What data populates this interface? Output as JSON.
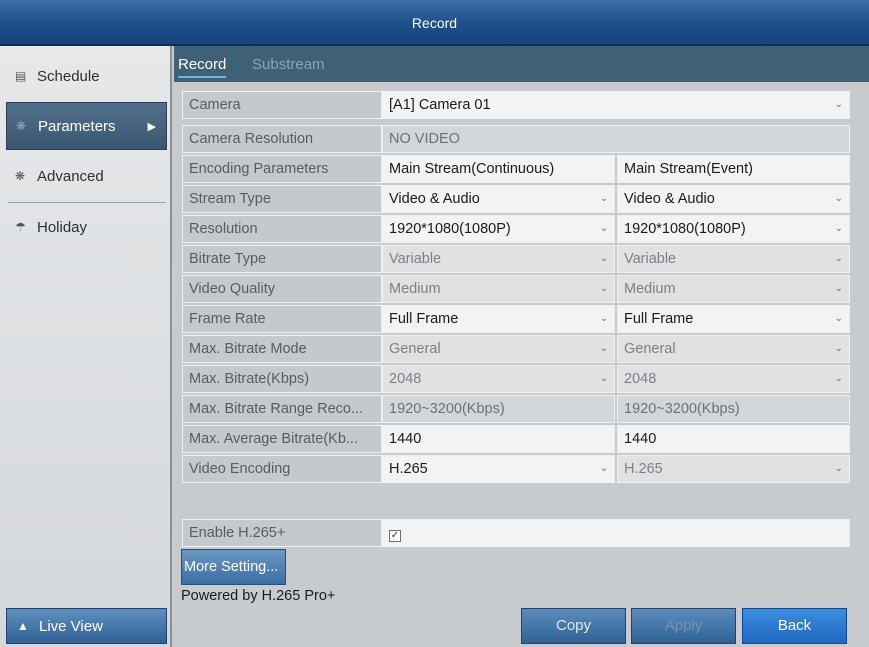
{
  "window": {
    "title": "Record"
  },
  "sidebar": {
    "items": [
      {
        "label": "Schedule",
        "icon": "schedule-icon"
      },
      {
        "label": "Parameters",
        "icon": "parameters-icon",
        "active": true
      },
      {
        "label": "Advanced",
        "icon": "advanced-icon"
      },
      {
        "label": "Holiday",
        "icon": "holiday-icon"
      }
    ],
    "live_view": "Live View"
  },
  "tabs": [
    {
      "label": "Record",
      "active": true
    },
    {
      "label": "Substream",
      "active": false
    }
  ],
  "form": {
    "camera": {
      "label": "Camera",
      "value": "[A1] Camera 01"
    },
    "camera_resolution": {
      "label": "Camera Resolution",
      "value": "NO VIDEO"
    },
    "encoding_parameters": {
      "label": "Encoding Parameters",
      "main": "Main Stream(Continuous)",
      "event": "Main Stream(Event)"
    },
    "stream_type": {
      "label": "Stream Type",
      "main": "Video & Audio",
      "event": "Video & Audio"
    },
    "resolution": {
      "label": "Resolution",
      "main": "1920*1080(1080P)",
      "event": "1920*1080(1080P)"
    },
    "bitrate_type": {
      "label": "Bitrate Type",
      "main": "Variable",
      "event": "Variable"
    },
    "video_quality": {
      "label": "Video Quality",
      "main": "Medium",
      "event": "Medium"
    },
    "frame_rate": {
      "label": "Frame Rate",
      "main": "Full Frame",
      "event": "Full Frame"
    },
    "max_bitrate_mode": {
      "label": "Max. Bitrate Mode",
      "main": "General",
      "event": "General"
    },
    "max_bitrate": {
      "label": "Max. Bitrate(Kbps)",
      "main": "2048",
      "event": "2048"
    },
    "max_bitrate_range": {
      "label": "Max. Bitrate Range Reco...",
      "main": "1920~3200(Kbps)",
      "event": "1920~3200(Kbps)"
    },
    "max_average_bitrate": {
      "label": "Max. Average Bitrate(Kb...",
      "main": "1440",
      "event": "1440"
    },
    "video_encoding": {
      "label": "Video Encoding",
      "main": "H.265",
      "event": "H.265"
    },
    "enable_h265plus": {
      "label": "Enable H.265+",
      "checked": true
    }
  },
  "buttons": {
    "more_setting": "More Setting...",
    "copy": "Copy",
    "apply": "Apply",
    "back": "Back"
  },
  "powered_by": "Powered by H.265 Pro+",
  "colors": {
    "title_bar": "#1e4f8a",
    "tab_bar": "#3f6176",
    "active_sidebar": "#3a5671",
    "back_button": "#1f68c0"
  }
}
